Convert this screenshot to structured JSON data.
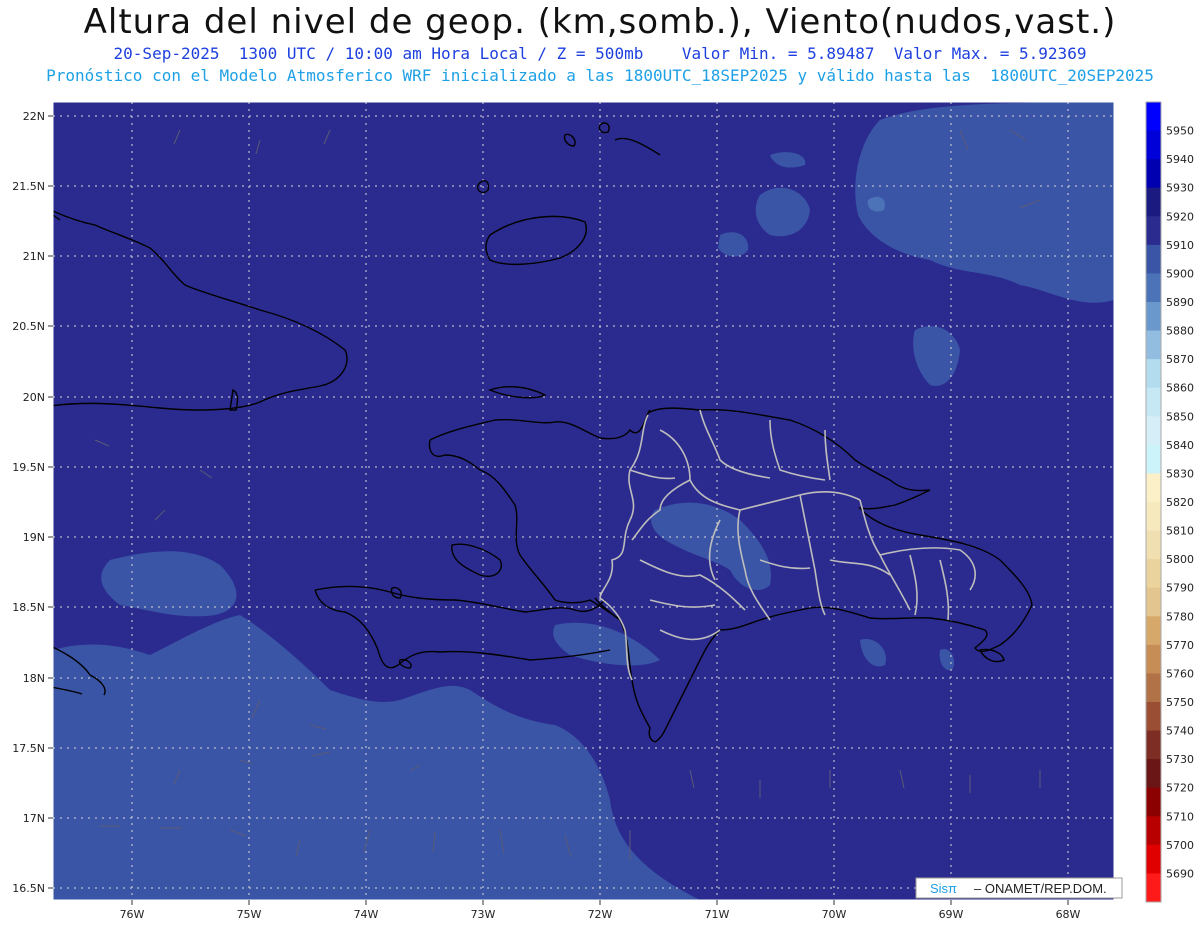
{
  "header": {
    "title": "Altura del nivel de geop. (km,somb.), Viento(nudos,vast.)",
    "subtitle_left": "20-Sep-2025  1300 UTC / 10:00 am Hora Local / Z = 500mb",
    "subtitle_right": "Valor Min. = 5.89487  Valor Max. = 5.92369",
    "description": "Pronóstico con el Modelo Atmosferico WRF inicializado a las 1800UTC_18SEP2025 y válido hasta las  1800UTC_20SEP2025"
  },
  "map": {
    "lat_labels": [
      "22N",
      "21.5N",
      "21N",
      "20.5N",
      "20N",
      "19.5N",
      "19N",
      "18.5N",
      "18N",
      "17.5N",
      "17N",
      "16.5N"
    ],
    "lon_labels": [
      "76W",
      "75W",
      "74W",
      "73W",
      "72W",
      "71W",
      "70W",
      "69W",
      "68W"
    ],
    "colors": {
      "fill_5900_5910": "#2b2b8f",
      "fill_5890_5900": "#3a55a6",
      "fill_5880_5890": "#4c72b8",
      "coast": "#000000",
      "borders": "#bdbdbd"
    }
  },
  "colorbar": {
    "labels": [
      "5950",
      "5940",
      "5930",
      "5920",
      "5910",
      "5900",
      "5890",
      "5880",
      "5870",
      "5860",
      "5850",
      "5840",
      "5830",
      "5820",
      "5810",
      "5800",
      "5790",
      "5780",
      "5770",
      "5760",
      "5750",
      "5740",
      "5730",
      "5720",
      "5710",
      "5700",
      "5690"
    ],
    "colors": [
      "#0000ff",
      "#0000d8",
      "#0000b0",
      "#1a1a80",
      "#2b2b8f",
      "#3a55a6",
      "#4c72b8",
      "#6a98cc",
      "#93bde0",
      "#b3dcef",
      "#c6e8f4",
      "#d6eef8",
      "#cdf3fa",
      "#fbf0c8",
      "#f6e9bd",
      "#f0dfb0",
      "#ead39c",
      "#e3c590",
      "#d6a96a",
      "#c68d57",
      "#b27248",
      "#9a4f35",
      "#7e2d25",
      "#6b1616",
      "#8b0000",
      "#b80000",
      "#e00000",
      "#ff1a1a"
    ]
  },
  "credit": {
    "brand": "Sisπ",
    "text": "– ONAMET/REP.DOM."
  }
}
